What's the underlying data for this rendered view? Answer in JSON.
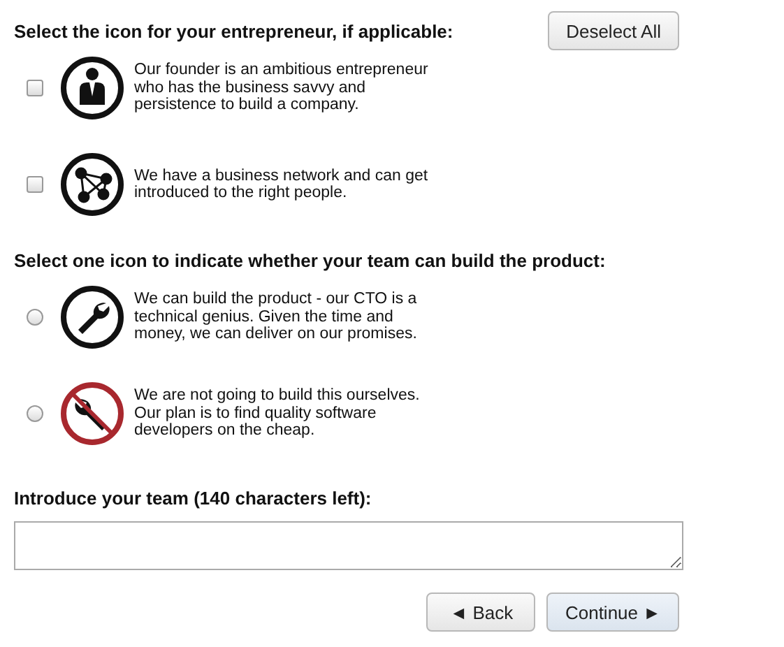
{
  "deselect_button": "Deselect All",
  "sections": [
    {
      "heading": "Select the icon for your entrepreneur, if applicable:",
      "kind": "checkbox",
      "options": [
        {
          "kind": "person",
          "text": "Our founder is an ambitious entrepreneur who has the business savvy and persistence to build a company.",
          "checked": false
        },
        {
          "kind": "network",
          "text": "We have a business network and can get introduced to the right people.",
          "checked": false
        }
      ]
    },
    {
      "heading": "Select one icon to indicate whether your team can build the product:",
      "kind": "radio",
      "options": [
        {
          "kind": "wrench",
          "text": "We can build the product - our CTO is a technical genius. Given the time and money, we can deliver on our promises.",
          "selected": false
        },
        {
          "kind": "no-wrench",
          "text": "We are not going to build this ourselves. Our plan is to find quality software developers on the cheap.",
          "selected": false
        }
      ]
    }
  ],
  "intro": {
    "label": "Introduce your team (140 characters left):"
  },
  "buttons": [
    {
      "kind": "back",
      "label": "◄ Back"
    },
    {
      "kind": "continue",
      "label": "Continue ►"
    }
  ]
}
